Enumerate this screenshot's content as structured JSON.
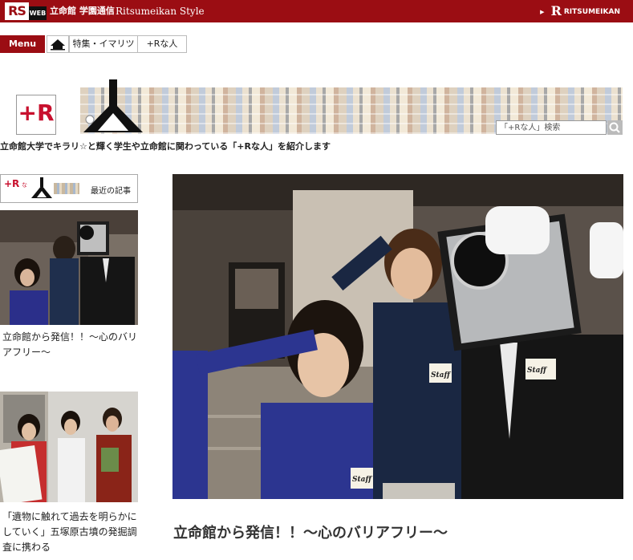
{
  "topbar": {
    "logo_rs": "RS",
    "logo_web": "WEB",
    "site_name_jp": "立命館 学園通信",
    "site_name_en": "Ritsumeikan Style",
    "brand": "RITSUMEIKAN",
    "brand_letter": "R"
  },
  "nav": {
    "menu_label": "Menu",
    "tabs": [
      {
        "label": "特集・イマリツ"
      },
      {
        "label": "+Rな人"
      }
    ]
  },
  "banner": {
    "logo_text": "+R",
    "search_placeholder": "「+Rな人」検索"
  },
  "tagline": "立命館大学でキラリ☆と輝く学生や立命館に関わっている「+Rな人」を紹介します",
  "sidebar": {
    "recent_logo": "+R",
    "recent_logo_na": "な",
    "recent_label": "最近の記事",
    "articles": [
      {
        "title": "立命館から発信！！～心のバリアフリー～"
      },
      {
        "title": "「遺物に触れて過去を明らかにしていく」五塚原古墳の発掘調査に携わる"
      }
    ]
  },
  "main": {
    "title": "立命館から発信！！～心のバリアフリー～",
    "badge_text": "Staff"
  },
  "colors": {
    "brand_red": "#9b0d13",
    "accent_red": "#c8102e"
  }
}
